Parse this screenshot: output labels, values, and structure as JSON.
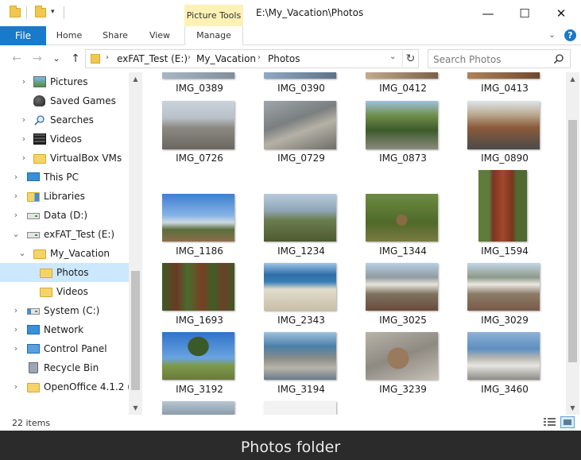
{
  "titlebar": {
    "contextual_tab": "Picture Tools",
    "title": "E:\\My_Vacation\\Photos",
    "minimize": "—",
    "maximize": "☐",
    "close": "✕"
  },
  "ribbon": {
    "tabs": [
      "File",
      "Home",
      "Share",
      "View",
      "Manage"
    ]
  },
  "navigation": {
    "back": "←",
    "forward": "→",
    "recent": "⌄",
    "up": "↑",
    "breadcrumb": [
      "exFAT_Test (E:)",
      "My_Vacation",
      "Photos"
    ],
    "refresh": "↻"
  },
  "search": {
    "placeholder": "Search Photos"
  },
  "nav_pane": {
    "items": [
      {
        "label": "Pictures",
        "icon": "pictures-icon"
      },
      {
        "label": "Saved Games",
        "icon": "saved-games-icon"
      },
      {
        "label": "Searches",
        "icon": "searches-icon"
      },
      {
        "label": "Videos",
        "icon": "videos-icon"
      },
      {
        "label": "VirtualBox VMs",
        "icon": "folder-icon"
      },
      {
        "label": "This PC",
        "icon": "this-pc-icon"
      },
      {
        "label": "Libraries",
        "icon": "libraries-icon"
      },
      {
        "label": "Data (D:)",
        "icon": "drive-icon"
      },
      {
        "label": "exFAT_Test (E:)",
        "icon": "drive-icon"
      },
      {
        "label": "My_Vacation",
        "icon": "folder-icon"
      },
      {
        "label": "Photos",
        "icon": "folder-icon"
      },
      {
        "label": "Videos",
        "icon": "folder-icon"
      },
      {
        "label": "System (C:)",
        "icon": "drive-icon"
      },
      {
        "label": "Network",
        "icon": "network-icon"
      },
      {
        "label": "Control Panel",
        "icon": "control-panel-icon"
      },
      {
        "label": "Recycle Bin",
        "icon": "recycle-bin-icon"
      },
      {
        "label": "OpenOffice 4.1.2 (en",
        "icon": "folder-icon"
      }
    ]
  },
  "files": {
    "top_row_partial": [
      "IMG_0389",
      "IMG_0390",
      "IMG_0412",
      "IMG_0413"
    ],
    "rows": [
      [
        "IMG_0726",
        "IMG_0729",
        "IMG_0873",
        "IMG_0890"
      ],
      [
        "IMG_1186",
        "IMG_1234",
        "IMG_1344",
        "IMG_1594"
      ],
      [
        "IMG_1693",
        "IMG_2343",
        "IMG_3025",
        "IMG_3029"
      ],
      [
        "IMG_3192",
        "IMG_3194",
        "IMG_3239",
        "IMG_3460"
      ]
    ]
  },
  "status": {
    "item_count": "22 items"
  },
  "caption": "Photos folder"
}
